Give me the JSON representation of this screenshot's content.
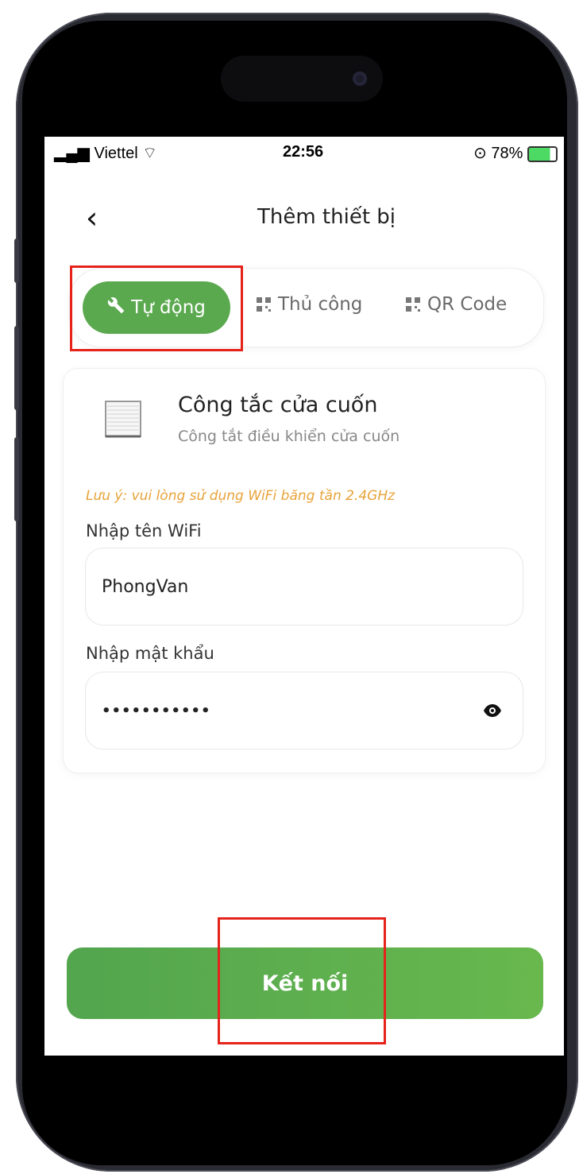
{
  "status_bar": {
    "carrier": "Viettel",
    "time": "22:56",
    "battery": "78%"
  },
  "header": {
    "title": "Thêm thiết bị",
    "back_icon": "chevron-left-icon"
  },
  "tabs": [
    {
      "label": "Tự động",
      "icon": "wrench-icon",
      "active": true
    },
    {
      "label": "Thủ công",
      "icon": "qr-grid-icon",
      "active": false
    },
    {
      "label": "QR Code",
      "icon": "qr-grid-icon",
      "active": false
    }
  ],
  "device": {
    "name": "Công tắc cửa cuốn",
    "description": "Công tắt điều khiển cửa cuốn",
    "icon": "rolling-shutter-icon"
  },
  "note": "Lưu ý: vui lòng sử dụng WiFi băng tần 2.4GHz",
  "wifi": {
    "label": "Nhập tên WiFi",
    "value": "PhongVan"
  },
  "password": {
    "label": "Nhập mật khẩu",
    "value": "•••••••••••",
    "toggle_icon": "eye-icon"
  },
  "connect_button": "Kết nối",
  "colors": {
    "accent": "#5ba94f",
    "note": "#e7a33a",
    "highlight": "#e5231b"
  }
}
